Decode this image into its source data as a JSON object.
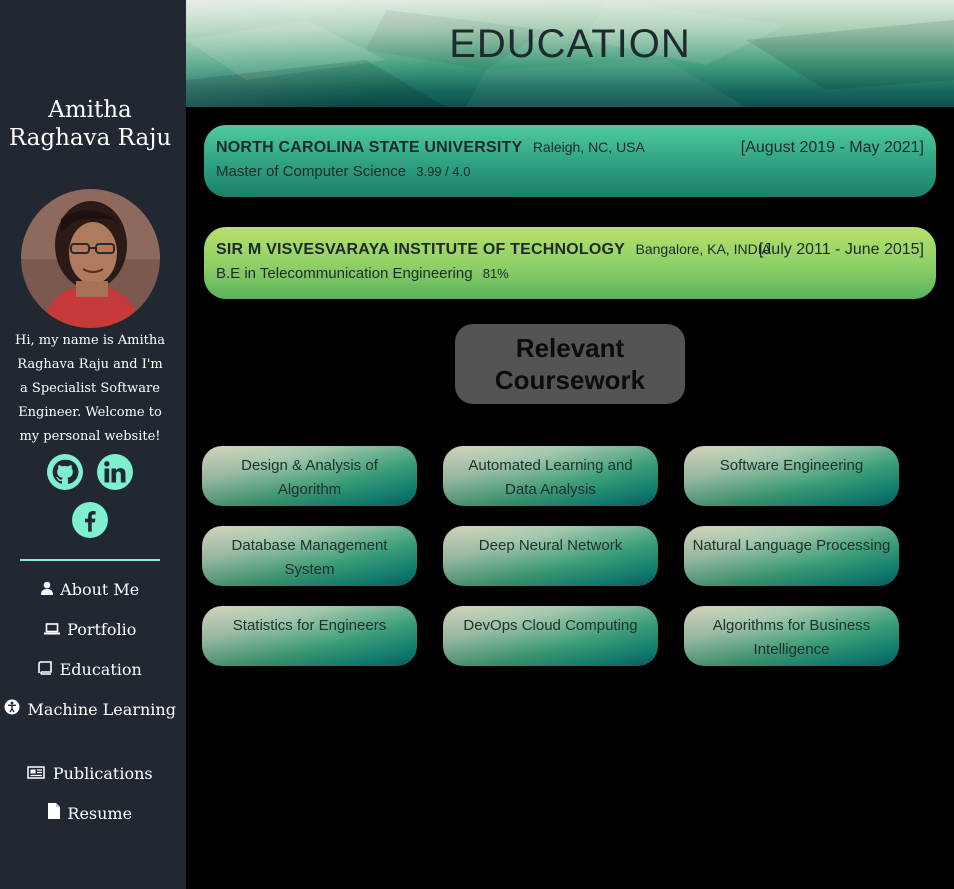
{
  "profile": {
    "name": "Amitha Raghava Raju",
    "bio": "Hi, my name is Amitha Raghava Raju and I'm a Specialist Software Engineer. Welcome to my personal website!"
  },
  "social": [
    {
      "icon": "github-icon"
    },
    {
      "icon": "linkedin-icon"
    },
    {
      "icon": "facebook-icon"
    }
  ],
  "nav": [
    {
      "label": "About Me",
      "icon": "user-icon"
    },
    {
      "label": "Portfolio",
      "icon": "laptop-icon"
    },
    {
      "label": "Education",
      "icon": "book-icon"
    },
    {
      "label": "Machine Learning",
      "icon": "accessibility-icon"
    },
    {
      "label": "Publications",
      "icon": "newspaper-icon"
    },
    {
      "label": "Resume",
      "icon": "file-icon"
    }
  ],
  "header": {
    "title": "EDUCATION"
  },
  "education": [
    {
      "school": "NORTH CAROLINA STATE UNIVERSITY",
      "location": "Raleigh, NC, USA",
      "dates": "[August 2019 - May 2021]",
      "degree": "Master of Computer Science",
      "grade": "3.99 / 4.0"
    },
    {
      "school": "SIR M VISVESVARAYA INSTITUTE OF TECHNOLOGY",
      "location": "Bangalore, KA, INDIA",
      "dates": "[July 2011 - June 2015]",
      "degree": "B.E in Telecommunication Engineering",
      "grade": "81%"
    }
  ],
  "coursework": {
    "title": "Relevant Coursework",
    "courses": [
      "Design & Analysis of Algorithm",
      "Automated Learning and Data Analysis",
      "Software Engineering",
      "Database Management System",
      "Deep Neural Network",
      "Natural Language Processing",
      "Statistics for Engineers",
      "DevOps Cloud Computing",
      "Algorithms for Business Intelligence"
    ]
  },
  "colors": {
    "sidebar": "#222831",
    "accent": "#7ff0cf",
    "ncsu_card": "#2ea080",
    "sir_card": "#8ccf66"
  }
}
